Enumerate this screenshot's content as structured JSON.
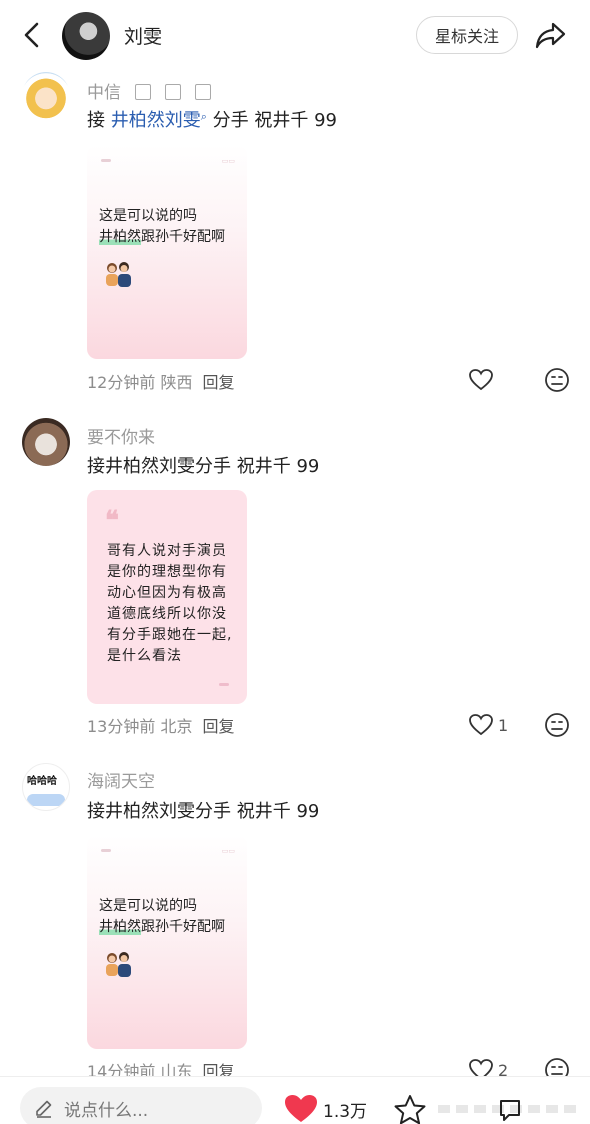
{
  "header": {
    "title": "刘雯",
    "follow_label": "星标关注"
  },
  "comments": [
    {
      "username": "中信",
      "text_prefix": "接 ",
      "text_link": "井柏然刘雯",
      "text_suffix": " 分手 祝井千 99",
      "time": "12分钟前",
      "location": "陕西",
      "reply_label": "回复",
      "like_count": "",
      "card": {
        "line1": "这是可以说的吗",
        "line2_hl": "井柏然",
        "line2_rest": "跟孙千好配啊"
      }
    },
    {
      "username": "要不你来",
      "text": "接井柏然刘雯分手 祝井千 99",
      "time": "13分钟前",
      "location": "北京",
      "reply_label": "回复",
      "like_count": "1",
      "card": {
        "lines": [
          "哥有人说对手演员",
          "是你的理想型你有",
          "动心但因为有极高",
          "道德底线所以你没",
          "有分手跟她在一起,",
          "是什么看法"
        ]
      }
    },
    {
      "username": "海阔天空",
      "avatar_text": "哈哈哈",
      "text": "接井柏然刘雯分手 祝井千 99",
      "time": "14分钟前",
      "location": "山东",
      "reply_label": "回复",
      "like_count": "2",
      "card": {
        "line1": "这是可以说的吗",
        "line2_hl": "井柏然",
        "line2_rest": "跟孙千好配啊"
      }
    }
  ],
  "bottom_bar": {
    "input_placeholder": "说点什么...",
    "like_count": "1.3万"
  },
  "colors": {
    "link": "#2a5db0",
    "heart": "#f0384f",
    "card_pink": "#fde1e8"
  }
}
